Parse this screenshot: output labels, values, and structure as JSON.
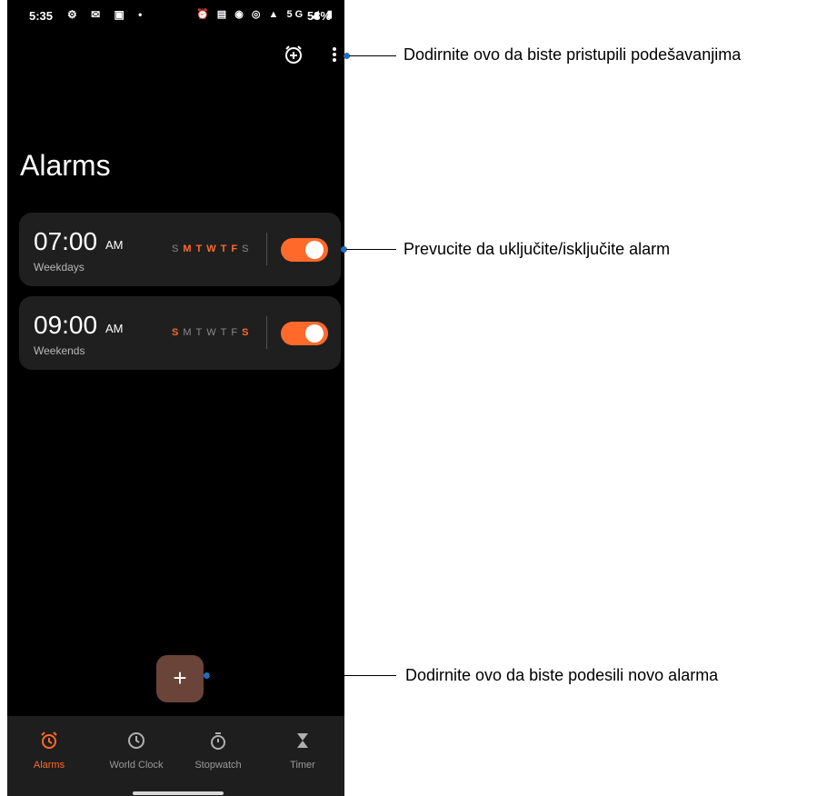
{
  "status_bar": {
    "time": "5:35",
    "left_icons": "⚙ ✉ ▣ •",
    "right_icons": "⏰ ▤ ◉ ◎ ▲ 5G ◢ ▮",
    "battery": "58%"
  },
  "header": {
    "title": "Alarms"
  },
  "alarms": [
    {
      "time": "07:00",
      "ampm": "AM",
      "label": "Weekdays",
      "days": [
        {
          "d": "S",
          "on": false
        },
        {
          "d": "M",
          "on": true
        },
        {
          "d": "T",
          "on": true
        },
        {
          "d": "W",
          "on": true
        },
        {
          "d": "T",
          "on": true
        },
        {
          "d": "F",
          "on": true
        },
        {
          "d": "S",
          "on": false
        }
      ],
      "enabled": true
    },
    {
      "time": "09:00",
      "ampm": "AM",
      "label": "Weekends",
      "days": [
        {
          "d": "S",
          "on": true
        },
        {
          "d": "M",
          "on": false
        },
        {
          "d": "T",
          "on": false
        },
        {
          "d": "W",
          "on": false
        },
        {
          "d": "T",
          "on": false
        },
        {
          "d": "F",
          "on": false
        },
        {
          "d": "S",
          "on": true
        }
      ],
      "enabled": true
    }
  ],
  "fab": {
    "label": "+"
  },
  "nav": {
    "items": [
      {
        "label": "Alarms",
        "icon": "alarm-icon",
        "active": true
      },
      {
        "label": "World Clock",
        "icon": "clock-icon",
        "active": false
      },
      {
        "label": "Stopwatch",
        "icon": "stopwatch-icon",
        "active": false
      },
      {
        "label": "Timer",
        "icon": "hourglass-icon",
        "active": false
      }
    ]
  },
  "callouts": {
    "settings": "Dodirnite ovo da biste pristupili podešavanjima",
    "toggle": "Prevucite da uključite/isključite alarm",
    "add": "Dodirnite ovo da biste podesili novo alarma"
  },
  "colors": {
    "accent": "#ff6a2b",
    "card": "#1f1f1f",
    "fab": "#6a4438",
    "callout_dot": "#1f6fbf"
  }
}
